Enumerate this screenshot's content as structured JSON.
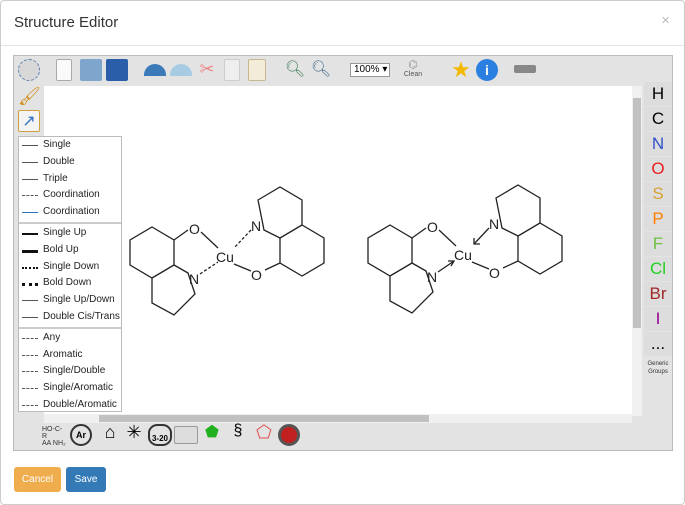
{
  "dialog": {
    "title": "Structure Editor",
    "close_label": "×"
  },
  "toolbar": {
    "zoom_value": "100% ▾",
    "clean_label": "Clean",
    "icons": [
      "lasso-select-icon",
      "new-icon",
      "open-icon",
      "save-file-icon",
      "undo-icon",
      "redo-icon",
      "cut-icon",
      "copy-icon",
      "paste-icon",
      "zoom-in-icon",
      "zoom-out-icon",
      "clean-icon",
      "favorite-star-icon",
      "info-icon",
      "templates-icon"
    ]
  },
  "left_tools": [
    "eraser-icon",
    "bond-tool-icon"
  ],
  "bond_menu": {
    "group1": [
      "Single",
      "Double",
      "Triple",
      "Coordination",
      "Coordination"
    ],
    "group2": [
      "Single Up",
      "Bold Up",
      "Single Down",
      "Bold Down",
      "Single Up/Down",
      "Double Cis/Trans"
    ],
    "group3": [
      "Any",
      "Aromatic",
      "Single/Double",
      "Single/Aromatic",
      "Double/Aromatic"
    ]
  },
  "atoms": [
    {
      "s": "H",
      "c": "#000000"
    },
    {
      "s": "C",
      "c": "#000000"
    },
    {
      "s": "N",
      "c": "#3050c8"
    },
    {
      "s": "O",
      "c": "#e82020"
    },
    {
      "s": "S",
      "c": "#d4a030"
    },
    {
      "s": "P",
      "c": "#ff8000"
    },
    {
      "s": "F",
      "c": "#70c040"
    },
    {
      "s": "Cl",
      "c": "#20d020"
    },
    {
      "s": "Br",
      "c": "#a02828"
    },
    {
      "s": "I",
      "c": "#940094"
    }
  ],
  "more_atoms": "...",
  "generic_groups": "Generic Groups",
  "molecules": {
    "labels": [
      "O",
      "N",
      "Cu",
      "N",
      "O"
    ]
  },
  "bottom_tools": [
    "amino-acid-icon",
    "aryl-icon",
    "bicyclic-icon",
    "chair-icon",
    "ring-3-20-icon",
    "functional-group-icon",
    "substituent-icon",
    "dna-icon",
    "fullerene-icon",
    "salts-icon"
  ],
  "bottom_labels": {
    "ar": "Ar",
    "ring": "3-20"
  },
  "buttons": {
    "cancel": "Cancel",
    "save": "Save"
  },
  "colors": {
    "cancel": "#f0ad4e",
    "save": "#337ab7"
  }
}
